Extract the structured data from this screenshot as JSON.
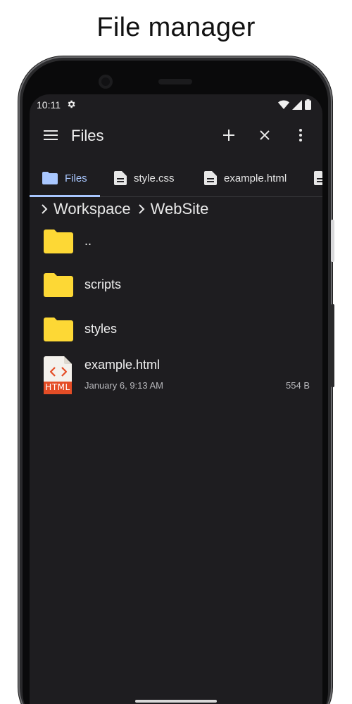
{
  "promo": {
    "title": "File manager"
  },
  "status_bar": {
    "time": "10:11"
  },
  "app_bar": {
    "title": "Files"
  },
  "tabs": [
    {
      "label": "Files",
      "icon": "folder-icon",
      "active": true
    },
    {
      "label": "style.css",
      "icon": "document-icon",
      "active": false
    },
    {
      "label": "example.html",
      "icon": "document-icon",
      "active": false
    }
  ],
  "breadcrumb": [
    {
      "label": "Workspace"
    },
    {
      "label": "WebSite"
    }
  ],
  "files": [
    {
      "name": "..",
      "type": "folder"
    },
    {
      "name": "scripts",
      "type": "folder"
    },
    {
      "name": "styles",
      "type": "folder"
    },
    {
      "name": "example.html",
      "type": "html-file",
      "date": "January 6, 9:13 AM",
      "size": "554 B",
      "badge": "HTML"
    }
  ],
  "colors": {
    "screen_bg": "#1e1d20",
    "accent": "#a9c7ff",
    "folder": "#fdd835",
    "html_badge": "#e44d26"
  }
}
